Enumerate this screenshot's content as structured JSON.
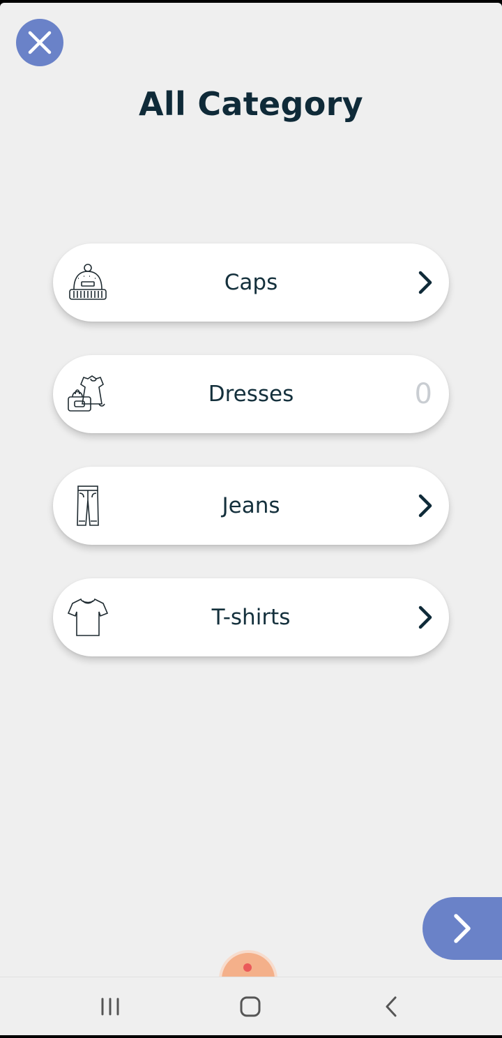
{
  "page": {
    "title": "All Category",
    "close_icon": "close-icon",
    "accent_color": "#6a82c8",
    "title_color": "#0f2a38"
  },
  "categories": [
    {
      "label": "Caps",
      "icon": "beanie-cap-icon",
      "trailing": "chevron"
    },
    {
      "label": "Dresses",
      "icon": "dress-and-bag-icon",
      "trailing": "count",
      "count": "0"
    },
    {
      "label": "Jeans",
      "icon": "jeans-icon",
      "trailing": "chevron"
    },
    {
      "label": "T-shirts",
      "icon": "tshirt-icon",
      "trailing": "chevron"
    }
  ],
  "next_button": {
    "icon": "chevron-right-icon"
  },
  "system_nav": {
    "recents_icon": "recents-icon",
    "home_icon": "home-icon",
    "back_icon": "back-icon"
  }
}
